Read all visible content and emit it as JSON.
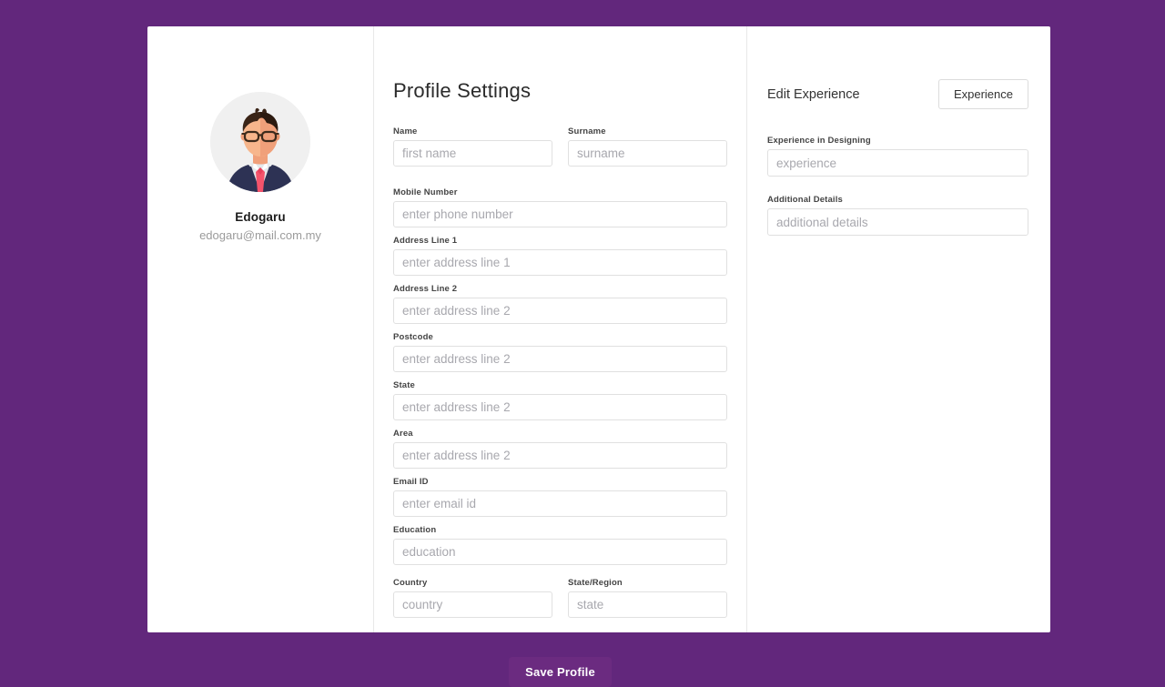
{
  "theme": {
    "background": "#62277c",
    "card_background": "#ffffff",
    "accent": "#6b2b80",
    "border": "#e0e0e0",
    "placeholder": "#a8a8ae"
  },
  "profile": {
    "avatar_icon": "user-avatar-illustration",
    "name": "Edogaru",
    "email": "edogaru@mail.com.my"
  },
  "form": {
    "title": "Profile Settings",
    "fields": [
      {
        "label": "Name",
        "placeholder": "first name",
        "value": "",
        "name": "first-name"
      },
      {
        "label": "Surname",
        "placeholder": "surname",
        "value": "",
        "name": "surname"
      },
      {
        "label": "Mobile Number",
        "placeholder": "enter phone number",
        "value": "",
        "name": "mobile-number"
      },
      {
        "label": "Address Line 1",
        "placeholder": "enter address line 1",
        "value": "",
        "name": "address-line-1"
      },
      {
        "label": "Address Line 2",
        "placeholder": "enter address line 2",
        "value": "",
        "name": "address-line-2"
      },
      {
        "label": "Postcode",
        "placeholder": "enter address line 2",
        "value": "",
        "name": "postcode"
      },
      {
        "label": "State",
        "placeholder": "enter address line 2",
        "value": "",
        "name": "state"
      },
      {
        "label": "Area",
        "placeholder": "enter address line 2",
        "value": "",
        "name": "area"
      },
      {
        "label": "Email ID",
        "placeholder": "enter email id",
        "value": "",
        "name": "email-id"
      },
      {
        "label": "Education",
        "placeholder": "education",
        "value": "",
        "name": "education"
      },
      {
        "label": "Country",
        "placeholder": "country",
        "value": "",
        "name": "country"
      },
      {
        "label": "State/Region",
        "placeholder": "state",
        "value": "",
        "name": "state-region"
      }
    ],
    "save_label": "Save Profile"
  },
  "experience": {
    "title": "Edit Experience",
    "button_label": "Experience",
    "fields": [
      {
        "label": "Experience in Designing",
        "placeholder": "experience",
        "value": "",
        "name": "experience-in-designing"
      },
      {
        "label": "Additional Details",
        "placeholder": "additional details",
        "value": "",
        "name": "additional-details"
      }
    ]
  }
}
